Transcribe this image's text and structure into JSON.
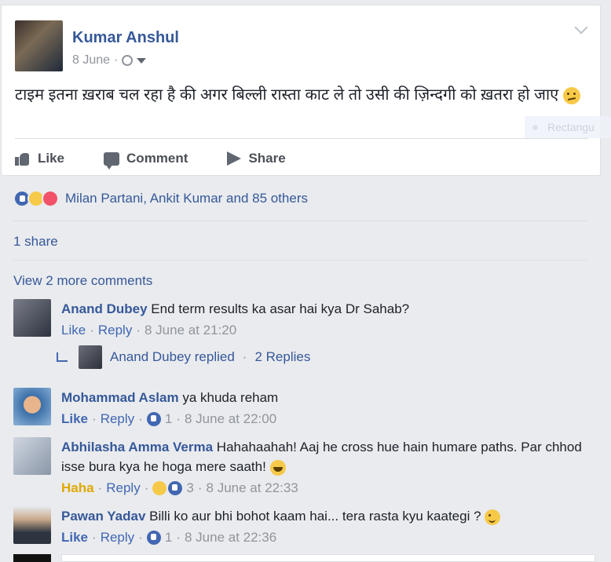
{
  "post": {
    "author": "Kumar Anshul",
    "date": "8 June",
    "date_sep": "·",
    "text": "टाइम इतना ख़राब चल रहा है की अगर बिल्ली रास्ता काट ले तो उसी की ज़िन्दगी को ख़तरा हो जाए",
    "actions": {
      "like": "Like",
      "comment": "Comment",
      "share": "Share"
    },
    "ghost_label": "Rectangu"
  },
  "reactions": {
    "names": "Milan Partani, Ankit Kumar and 85 others",
    "types": [
      "like-icon",
      "haha-icon",
      "love-icon"
    ]
  },
  "shares": "1 share",
  "view_more": "View 2 more comments",
  "comments": [
    {
      "name": "Anand Dubey",
      "text": "End term results ka asar hai kya Dr Sahab?",
      "like": "Like",
      "reply": "Reply",
      "time": "8 June at 21:20"
    },
    {
      "name": "Mohammad Aslam",
      "text": "ya khuda reham",
      "like": "Like",
      "reply": "Reply",
      "count": "1",
      "time": "8 June at 22:00"
    },
    {
      "name": "Abhilasha Amma Verma",
      "text": "Hahahaahah! Aaj he cross hue hain humare paths. Par chhod isse bura kya he hoga mere saath!",
      "like": "Haha",
      "reply": "Reply",
      "count": "3",
      "time": "8 June at 22:33"
    },
    {
      "name": "Pawan Yadav",
      "text": "Billi ko aur bhi bohot kaam hai... tera rasta kyu kaategi ?",
      "like": "Like",
      "reply": "Reply",
      "count": "1",
      "time": "8 June at 22:36"
    }
  ],
  "reply_summary": {
    "text": "Anand Dubey replied",
    "sep": "·",
    "count": "2 Replies"
  },
  "sep": "·"
}
